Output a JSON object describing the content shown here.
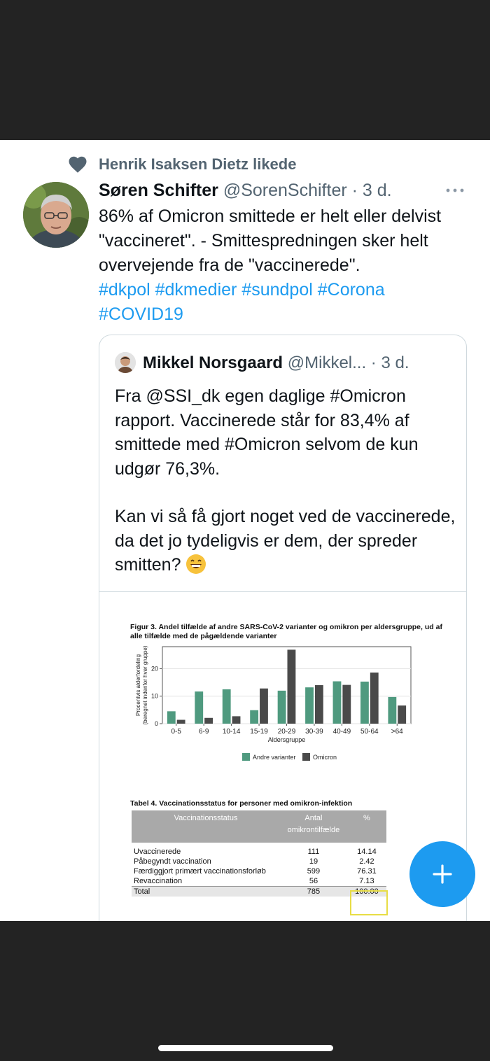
{
  "social_context": {
    "text": "Henrik Isaksen Dietz likede"
  },
  "tweet": {
    "author_name": "Søren Schifter",
    "author_handle": "@SorenSchifter",
    "separator": " · ",
    "time": "3 d.",
    "text": "86% af Omicron smittede er helt eller delvist \"vaccineret\". - Smittespredningen sker helt overvejende fra de \"vaccinerede\".",
    "hashtags": [
      "#dkpol",
      "#dkmedier",
      "#sundpol",
      "#Corona",
      "#COVID19"
    ]
  },
  "quote": {
    "author_name": "Mikkel Norsgaard",
    "author_handle": "@Mikkel...",
    "separator": " · ",
    "time": "3 d.",
    "paragraph1": "Fra @SSI_dk egen daglige #Omicron rapport. Vaccinerede står for 83,4% af smittede med #Omicron selvom de kun udgør 76,3%.",
    "paragraph2": "Kan vi så få gjort noget ved de vaccinerede, da det jo tydeligvis er dem, der spreder smitten?"
  },
  "figure": {
    "title": "Figur 3.  Andel tilfælde af andre SARS-CoV-2 varianter og omikron per aldersgruppe, ud af alle tilfælde med de pågældende varianter"
  },
  "chart_data": {
    "type": "bar",
    "title": "Figur 3.  Andel tilfælde af andre SARS-CoV-2 varianter og omikron per aldersgruppe, ud af alle tilfælde med de pågældende varianter",
    "categories": [
      "0-5",
      "6-9",
      "10-14",
      "15-19",
      "20-29",
      "30-39",
      "40-49",
      "50-64",
      ">64"
    ],
    "series": [
      {
        "name": "Andre varianter",
        "values": [
          4.5,
          11.7,
          12.5,
          4.9,
          12.0,
          13.2,
          15.4,
          15.3,
          9.7
        ],
        "color": "#4f9a7f"
      },
      {
        "name": "Omicron",
        "values": [
          1.4,
          2.1,
          2.7,
          12.8,
          26.9,
          14.0,
          14.1,
          18.6,
          6.6
        ],
        "color": "#4a4a4a"
      }
    ],
    "xlabel": "Aldersgruppe",
    "ylabel": "Procentvis alderfordeling (beregnet indenfor hver gruppe)",
    "ylim": [
      0,
      28
    ],
    "yticks": [
      0,
      10,
      20
    ],
    "grid": true,
    "legend_position": "bottom"
  },
  "table": {
    "title": "Tabel 4. Vaccinationsstatus for personer med omikron-infektion",
    "headers": [
      "Vaccinationsstatus",
      "Antal\nomikrontilfælde",
      "%"
    ],
    "rows": [
      [
        "Uvaccinerede",
        "111",
        "14.14"
      ],
      [
        "Påbegyndt vaccination",
        "19",
        "2.42"
      ],
      [
        "Færdiggjort primært vaccinationsforløb",
        "599",
        "76.31"
      ],
      [
        "Revaccination",
        "56",
        "7.13"
      ]
    ],
    "total": [
      "Total",
      "785",
      "100.00"
    ]
  },
  "colors": {
    "accent": "#1d9bf0",
    "text_primary": "#0f1419",
    "text_secondary": "#536471",
    "highlight_box": "#e8dd45"
  },
  "icons": {
    "social_context": "heart-icon",
    "more": "more-horizontal-icon",
    "fab": "plus-icon",
    "emoji": "grinning-face-emoji"
  }
}
